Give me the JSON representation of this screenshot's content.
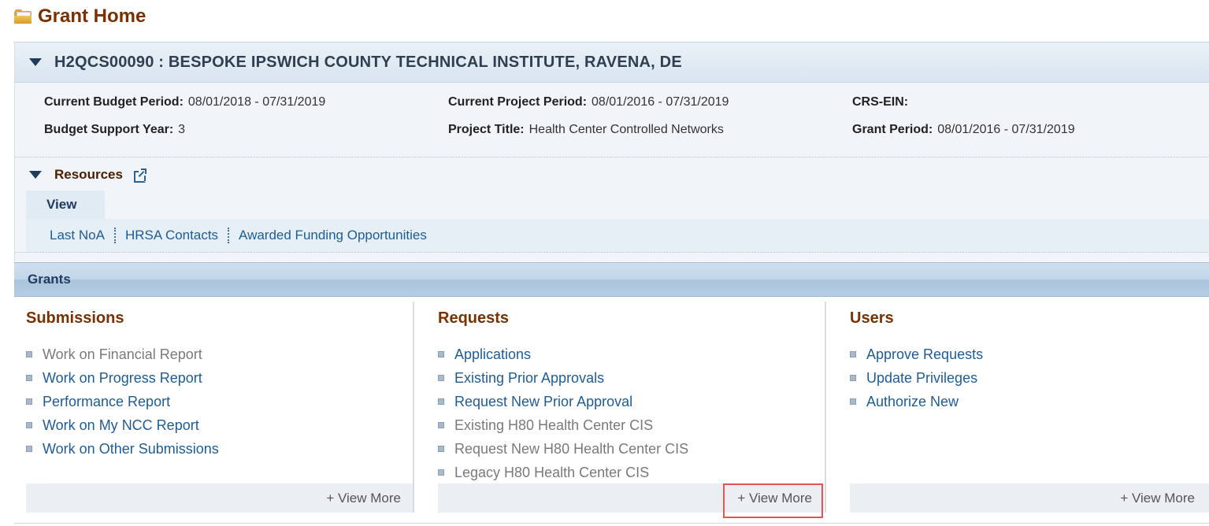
{
  "page": {
    "title": "Grant Home"
  },
  "grant": {
    "header": "H2QCS00090 : BESPOKE IPSWICH COUNTY TECHNICAL INSTITUTE, RAVENA, DE",
    "fields": {
      "current_budget_period": {
        "label": "Current Budget Period:",
        "value": "08/01/2018 - 07/31/2019"
      },
      "budget_support_year": {
        "label": "Budget Support Year:",
        "value": "3"
      },
      "current_project_period": {
        "label": "Current Project Period:",
        "value": "08/01/2016 - 07/31/2019"
      },
      "project_title": {
        "label": "Project Title:",
        "value": "Health Center Controlled Networks"
      },
      "crs_ein": {
        "label": "CRS-EIN:",
        "value": ""
      },
      "grant_period": {
        "label": "Grant Period:",
        "value": "08/01/2016 - 07/31/2019"
      }
    }
  },
  "resources": {
    "title": "Resources",
    "tab_label": "View",
    "links": [
      "Last NoA",
      "HRSA Contacts",
      "Awarded Funding Opportunities"
    ]
  },
  "grants": {
    "title": "Grants",
    "submissions": {
      "title": "Submissions",
      "items": [
        {
          "label": "Work on Financial Report",
          "enabled": false
        },
        {
          "label": "Work on Progress Report",
          "enabled": true
        },
        {
          "label": "Performance Report",
          "enabled": true
        },
        {
          "label": "Work on My NCC Report",
          "enabled": true
        },
        {
          "label": "Work on Other Submissions",
          "enabled": true
        }
      ],
      "view_more": "+ View More"
    },
    "requests": {
      "title": "Requests",
      "items": [
        {
          "label": "Applications",
          "enabled": true
        },
        {
          "label": "Existing Prior Approvals",
          "enabled": true
        },
        {
          "label": "Request New Prior Approval",
          "enabled": true
        },
        {
          "label": "Existing H80 Health Center CIS",
          "enabled": false
        },
        {
          "label": "Request New H80 Health Center CIS",
          "enabled": false
        },
        {
          "label": "Legacy H80 Health Center CIS",
          "enabled": false
        }
      ],
      "view_more": "+ View More"
    },
    "users": {
      "title": "Users",
      "items": [
        {
          "label": "Approve Requests",
          "enabled": true
        },
        {
          "label": "Update Privileges",
          "enabled": true
        },
        {
          "label": "Authorize New",
          "enabled": true
        }
      ],
      "view_more": "+ View More"
    }
  },
  "colors": {
    "title_brown": "#7a3100",
    "link_blue": "#1f5c94",
    "disabled_gray": "#7a7a7a",
    "highlight_red": "#e05555"
  }
}
